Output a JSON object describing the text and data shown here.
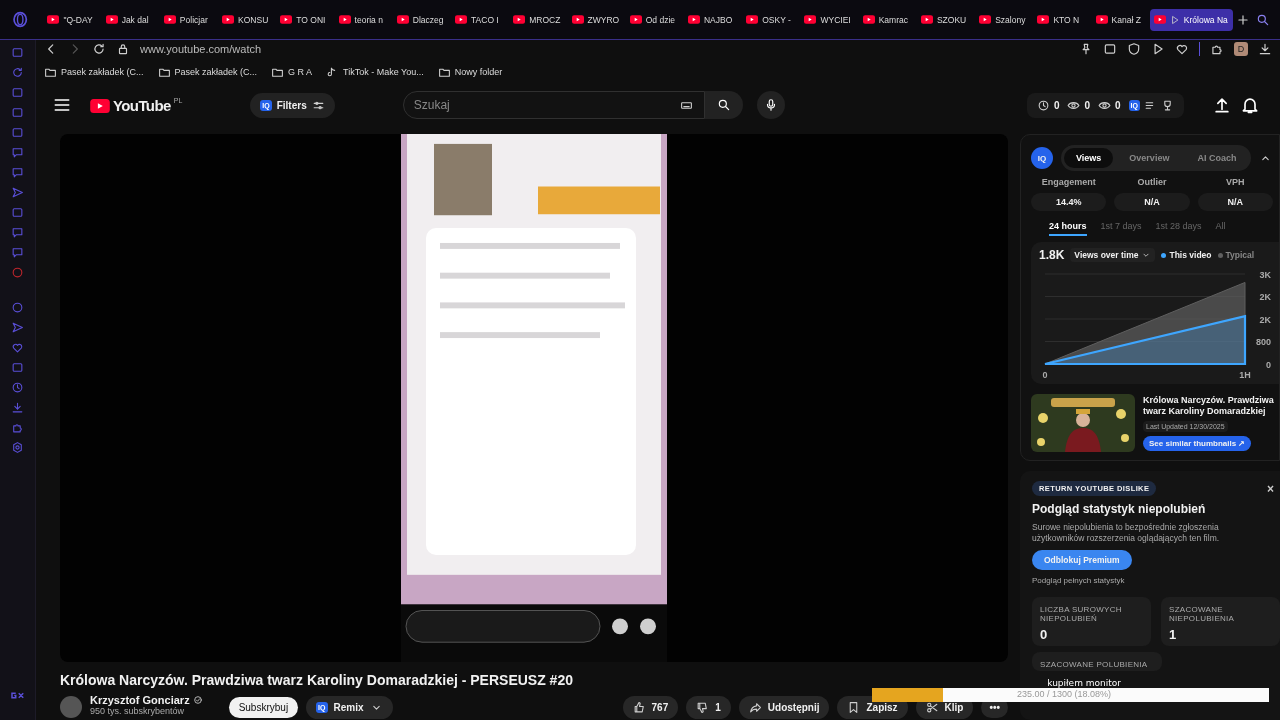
{
  "browser": {
    "tabs": [
      {
        "title": "\"Q-DAY",
        "selected": false
      },
      {
        "title": "Jak dal",
        "selected": false
      },
      {
        "title": "Policjar",
        "selected": false
      },
      {
        "title": "KONSU",
        "selected": false
      },
      {
        "title": "TO ONI",
        "selected": false
      },
      {
        "title": "teoria n",
        "selected": false
      },
      {
        "title": "Dlaczeg",
        "selected": false
      },
      {
        "title": "TACO I",
        "selected": false
      },
      {
        "title": "MROCZ",
        "selected": false
      },
      {
        "title": "ZWYRO",
        "selected": false
      },
      {
        "title": "Od dzie",
        "selected": false
      },
      {
        "title": "NAJBO",
        "selected": false
      },
      {
        "title": "OSKY -",
        "selected": false
      },
      {
        "title": "WYCIEI",
        "selected": false
      },
      {
        "title": "Kamrac",
        "selected": false
      },
      {
        "title": "SZOKU",
        "selected": false
      },
      {
        "title": "Szalony",
        "selected": false
      },
      {
        "title": "KTO N",
        "selected": false
      },
      {
        "title": "Kanał Z",
        "selected": false
      },
      {
        "title": "Królowa Na",
        "selected": true
      }
    ],
    "address": "www.youtube.com/watch",
    "profile_initial": "D",
    "bookmarks": [
      {
        "label": "Pasek zakładek (C...",
        "kind": "folder"
      },
      {
        "label": "Pasek zakładek (C...",
        "kind": "folder"
      },
      {
        "label": "G R A",
        "kind": "folder"
      },
      {
        "label": "TikTok - Make You...",
        "kind": "tiktok"
      },
      {
        "label": "Nowy folder",
        "kind": "folder"
      }
    ]
  },
  "youtube": {
    "logo": "YouTube",
    "region": "PL",
    "filters": "Filters",
    "filters_badge": "IQ",
    "toolbar_badge": "IQ",
    "search_placeholder": "Szukaj",
    "counters": [
      "0",
      "0",
      "0"
    ]
  },
  "video": {
    "kind": "picture",
    "title": "Królowa Narcyzów. Prawdziwa twarz Karoliny Domaradzkiej - PERSEUSZ #20",
    "channel": "Krzysztof Gonciarz",
    "subscribers": "950 tys. subskrybentów",
    "subscribe": "Subskrybuj",
    "remix_badge": "IQ",
    "remix": "Remix",
    "likes": "767",
    "dislikes": "1",
    "share": "Udostępnij",
    "save": "Zapisz",
    "clip": "Klip",
    "more": "•••"
  },
  "vidiq": {
    "badge": "IQ",
    "tabs": [
      {
        "label": "Views",
        "selected": true
      },
      {
        "label": "Overview",
        "selected": false
      },
      {
        "label": "AI Coach",
        "selected": false
      }
    ],
    "metrics": [
      {
        "label": "Engagement",
        "value": "14.4%"
      },
      {
        "label": "Outlier",
        "value": "N/A"
      },
      {
        "label": "VPH",
        "value": "N/A"
      }
    ],
    "periods": [
      {
        "label": "24 hours",
        "selected": true
      },
      {
        "label": "1st 7 days",
        "selected": false
      },
      {
        "label": "1st 28 days",
        "selected": false
      },
      {
        "label": "All",
        "selected": false
      }
    ],
    "total": "1.8K",
    "metric_menu": "Views over time",
    "chart_data": {
      "type": "area",
      "x": [
        0,
        1
      ],
      "xlim": [
        0,
        1
      ],
      "grid": true,
      "series": [
        {
          "name": "This video",
          "color": "#3ea6ff",
          "values": [
            0,
            1700
          ]
        },
        {
          "name": "Typical",
          "color": "#5f5f5f",
          "values": [
            0,
            2900
          ]
        }
      ],
      "xticks": [
        {
          "value": 0,
          "label": "0"
        },
        {
          "value": 1,
          "label": "1H"
        }
      ],
      "yticks": [
        {
          "value": 0,
          "label": "0"
        },
        {
          "value": 800,
          "label": "800"
        },
        {
          "value": 1600,
          "label": "2K"
        },
        {
          "value": 2400,
          "label": "2K"
        },
        {
          "value": 3200,
          "label": "3K"
        }
      ],
      "ylim": [
        0,
        3200
      ]
    },
    "thumb": {
      "title": "Królowa Narcyzów. Prawdziwa twarz Karoliny Domaradzkiej",
      "updated": "Last Updated 12/30/2025",
      "button": "See similar thumbnails ↗"
    }
  },
  "dislike": {
    "badge": "RETURN YOUTUBE DISLIKE",
    "close": "×",
    "heading": "Podgląd statystyk niepolubień",
    "text": "Surowe niepolubienia to bezpośrednie zgłoszenia użytkowników rozszerzenia oglądających ten film.",
    "button": "Odblokuj Premium",
    "link": "Podgląd pełnych statystyk",
    "stats": [
      {
        "label": "LICZBA SUROWYCH NIEPOLUBIEŃ",
        "value": "0"
      },
      {
        "label": "SZACOWANE NIEPOLUBIENIA",
        "value": "1"
      }
    ],
    "next_label": "SZACOWANE POLUBIENIA"
  },
  "goal": {
    "label": "kupiłem monitor",
    "reading": "235.00 / 1300 (18.08%)",
    "level": 0.18
  }
}
